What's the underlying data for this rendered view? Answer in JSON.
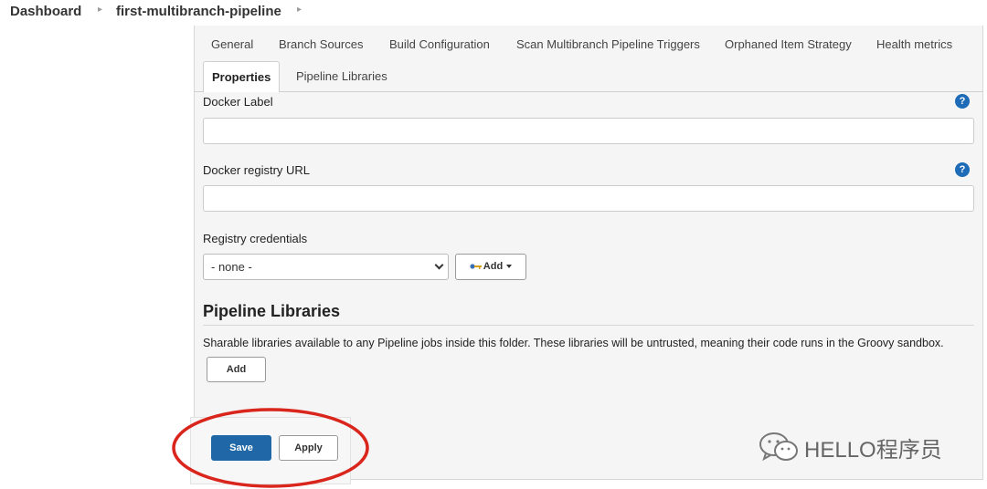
{
  "breadcrumb": {
    "items": [
      "Dashboard",
      "first-multibranch-pipeline"
    ]
  },
  "tabs": {
    "row1": [
      "General",
      "Branch Sources",
      "Build Configuration",
      "Scan Multibranch Pipeline Triggers",
      "Orphaned Item Strategy",
      "Health metrics"
    ],
    "row2": [
      "Properties",
      "Pipeline Libraries"
    ],
    "active": "Properties"
  },
  "docker": {
    "label_field": {
      "label": "Docker Label",
      "value": ""
    },
    "registry_url": {
      "label": "Docker registry URL",
      "value": ""
    },
    "credentials": {
      "label": "Registry credentials",
      "selected": "- none -",
      "add_label": "Add"
    }
  },
  "pipeline_libraries": {
    "title": "Pipeline Libraries",
    "description": "Sharable libraries available to any Pipeline jobs inside this folder. These libraries will be untrusted, meaning their code runs in the Groovy sandbox.",
    "add_label": "Add"
  },
  "actions": {
    "save_label": "Save",
    "apply_label": "Apply"
  },
  "watermark": {
    "text": "HELLO程序员"
  },
  "colors": {
    "primary": "#1f67a6",
    "annotation": "#d9251c",
    "help": "#1e6bb8"
  },
  "icons": {
    "help": "help-icon",
    "key": "key-icon",
    "wechat": "wechat-icon"
  }
}
